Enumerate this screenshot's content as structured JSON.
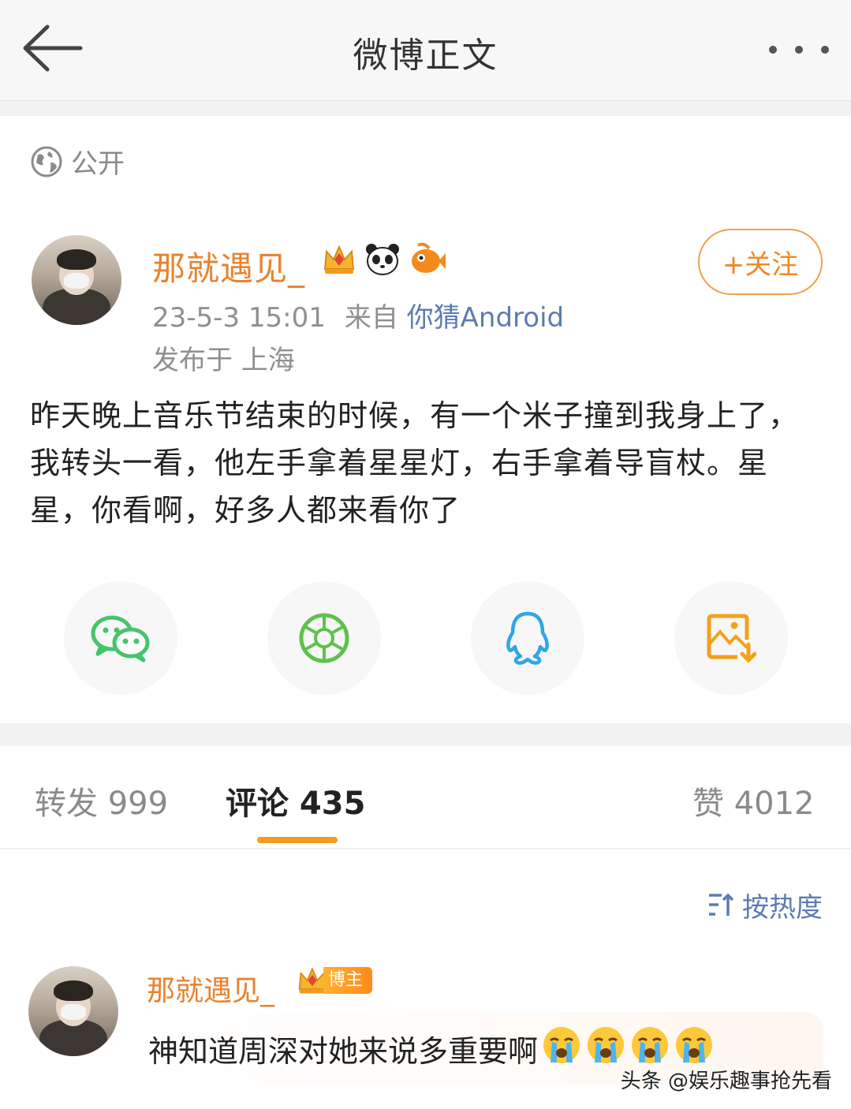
{
  "nav": {
    "title": "微博正文"
  },
  "post": {
    "visibility": "公开",
    "author": "那就遇见_",
    "follow_label": "+关注",
    "time": "23-5-3 15:01",
    "from_label": "来自",
    "source": "你猜Android",
    "location": "发布于 上海",
    "text": "昨天晚上音乐节结束的时候，有一个米子撞到我身上了，我转头一看，他左手拿着星星灯，右手拿着导盲杖。星星，你看啊，好多人都来看你了"
  },
  "share": {
    "items": [
      {
        "icon": "wechat-icon",
        "color": "#45c46c"
      },
      {
        "icon": "moments-icon",
        "color": "#5ec24a"
      },
      {
        "icon": "qq-icon",
        "color": "#2fa6e6"
      },
      {
        "icon": "save-image-icon",
        "color": "#f2a21a"
      }
    ]
  },
  "tabs": {
    "repost": "转发 999",
    "comments": "评论 435",
    "likes": "赞 4012"
  },
  "comments": {
    "sort_label": "按热度",
    "items": [
      {
        "author": "那就遇见_",
        "badge": "博主",
        "text": "神知道周深对她来说多重要啊",
        "emoji_count": 4
      }
    ]
  },
  "watermark": "头条 @娱乐趣事抢先看",
  "colors": {
    "accent": "#f39c1f",
    "name": "#e8822d",
    "link": "#5b7bb3"
  }
}
